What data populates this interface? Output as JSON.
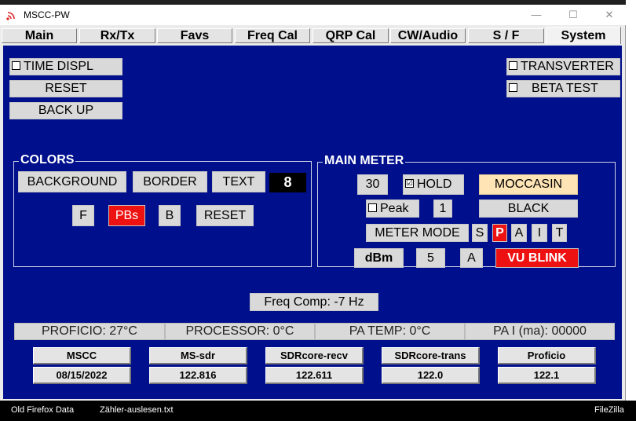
{
  "window": {
    "title": "MSCC-PW",
    "minimize": "—",
    "maximize": "☐",
    "close": "✕"
  },
  "tabs": [
    "Main",
    "Rx/Tx",
    "Favs",
    "Freq Cal",
    "QRP Cal",
    "CW/Audio",
    "S / F",
    "System"
  ],
  "active_tab": "System",
  "left_controls": {
    "time_displ": "TIME DISPL",
    "reset": "RESET",
    "back_up": "BACK UP"
  },
  "right_controls": {
    "transverter": "TRANSVERTER",
    "beta_test": "BETA TEST"
  },
  "colors": {
    "legend": "COLORS",
    "background": "BACKGROUND",
    "border": "BORDER",
    "text": "TEXT",
    "value": "8",
    "f": "F",
    "pbs": "PBs",
    "b": "B",
    "reset": "RESET"
  },
  "main_meter": {
    "legend": "MAIN METER",
    "value_30": "30",
    "hold": "HOLD",
    "hold_checked": "☑",
    "color_name": "MOCCASIN",
    "peak": "Peak",
    "value_1": "1",
    "black": "BLACK",
    "meter_mode": "METER MODE",
    "modes": [
      "S",
      "P",
      "A",
      "I",
      "T"
    ],
    "active_mode": "P",
    "dbm": "dBm",
    "value_5": "5",
    "a": "A",
    "vu_blink": "VU BLINK"
  },
  "freq_comp": "Freq Comp: -7 Hz",
  "status": [
    "PROFICIO: 27°C",
    "PROCESSOR: 0°C",
    "PA TEMP: 0°C",
    "PA I (ma): 00000"
  ],
  "versions": [
    {
      "name": "MSCC",
      "value": "08/15/2022"
    },
    {
      "name": "MS-sdr",
      "value": "122.816"
    },
    {
      "name": "SDRcore-recv",
      "value": "122.611"
    },
    {
      "name": "SDRcore-trans",
      "value": "122.0"
    },
    {
      "name": "Proficio",
      "value": "122.1"
    }
  ],
  "taskbar": [
    "Old Firefox Data",
    "Zähler-auslesen.txt",
    "FileZilla"
  ],
  "colors_theme": {
    "panel": "#000f8c",
    "accent_red": "#ee1111",
    "moccasin": "#ffe4b5"
  }
}
